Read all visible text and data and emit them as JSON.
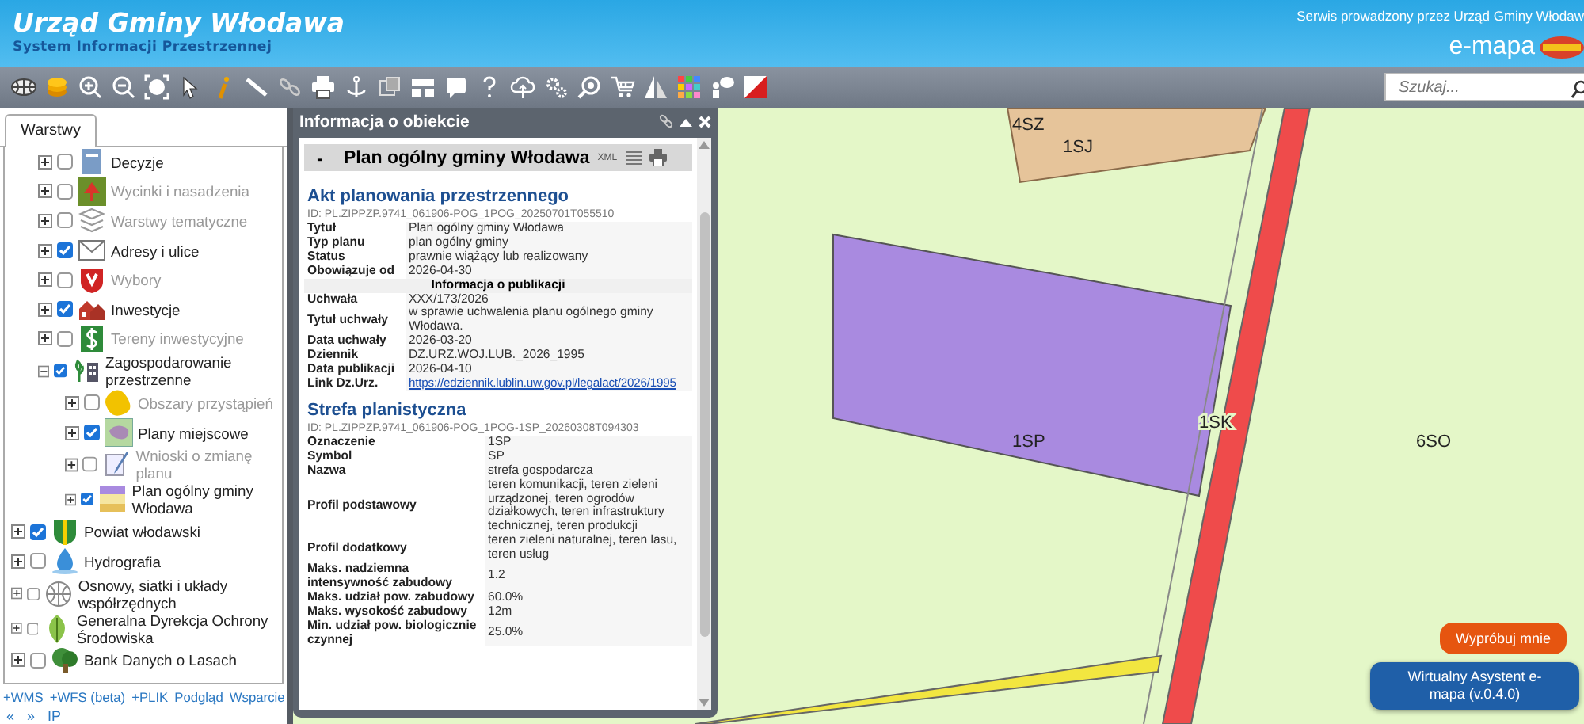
{
  "header": {
    "title": "Urząd Gminy Włodawa",
    "subtitle": "System Informacji Przestrzennej",
    "operator_note": "Serwis prowadzony przez Urząd Gminy Włodaw",
    "logo_text": "e-mapa"
  },
  "toolbar": {
    "search": {
      "placeholder": "Szukaj..."
    }
  },
  "layers_panel": {
    "tabs": [
      {
        "label": "Warstwy",
        "selected": true
      }
    ],
    "partial_group": [
      {
        "label": "Decyzje",
        "checked": false,
        "disabled": false,
        "expanded": false
      },
      {
        "label": "Wycinki i nasadzenia",
        "checked": false,
        "disabled": true,
        "expanded": false
      },
      {
        "label": "Warstwy tematyczne",
        "checked": false,
        "disabled": true,
        "expanded": false
      },
      {
        "label": "Adresy i ulice",
        "checked": true,
        "disabled": false,
        "expanded": false
      },
      {
        "label": "Wybory",
        "checked": false,
        "disabled": true,
        "expanded": false
      },
      {
        "label": "Inwestycje",
        "checked": true,
        "disabled": false,
        "expanded": false
      },
      {
        "label": "Tereny inwestycyjne",
        "checked": false,
        "disabled": true,
        "expanded": false
      },
      {
        "label": "Zagospodarowanie przestrzenne",
        "checked": true,
        "disabled": false,
        "expanded": true,
        "children": [
          {
            "label": "Obszary przystąpień",
            "checked": false,
            "disabled": true,
            "expanded": false
          },
          {
            "label": "Plany miejscowe",
            "checked": true,
            "disabled": false,
            "expanded": false
          },
          {
            "label": "Wnioski o zmianę planu",
            "checked": false,
            "disabled": true,
            "expanded": false
          },
          {
            "label": "Plan ogólny gminy Włodawa",
            "checked": true,
            "disabled": false,
            "expanded": false
          }
        ]
      }
    ],
    "items": [
      {
        "label": "Powiat włodawski",
        "checked": true,
        "disabled": false,
        "expanded": false
      },
      {
        "label": "Hydrografia",
        "checked": false,
        "disabled": false,
        "expanded": false
      },
      {
        "label": "Osnowy, siatki i układy współrzędnych",
        "checked": false,
        "disabled": false,
        "expanded": false
      },
      {
        "label": "Generalna Dyrekcja Ochrony Środowiska",
        "checked": false,
        "disabled": false,
        "expanded": false
      },
      {
        "label": "Bank Danych o Lasach",
        "checked": false,
        "disabled": false,
        "expanded": false
      }
    ],
    "links": [
      "+WMS",
      "+WFS (beta)",
      "+PLIK",
      "Podgląd",
      "Wsparcie"
    ],
    "footer_links": [
      "«",
      "»",
      "IP"
    ]
  },
  "info_popup": {
    "title": "Informacja o obiekcie",
    "object": {
      "collapse_symbol": "-",
      "title": "Plan ogólny gminy Włodawa",
      "xml_label": "XML"
    },
    "sections": [
      {
        "title": "Akt planowania przestrzennego",
        "id_line": "ID: PL.ZIPPZP.9741_061906-POG_1POG_20250701T055510",
        "rows": [
          {
            "kind": "field",
            "label": "Tytuł",
            "value": "Plan ogólny gminy Włodawa"
          },
          {
            "kind": "field",
            "label": "Typ planu",
            "value": "plan ogólny gminy"
          },
          {
            "kind": "field",
            "label": "Status",
            "value": "prawnie wiążący lub realizowany"
          },
          {
            "kind": "field",
            "label": "Obowiązuje od",
            "value": "2026-04-30"
          },
          {
            "kind": "subheader",
            "label": "Informacja o publikacji"
          },
          {
            "kind": "field",
            "label": "Uchwała",
            "value": "XXX/173/2026"
          },
          {
            "kind": "field",
            "label": "Tytuł uchwały",
            "value": "w sprawie uchwalenia planu ogólnego gminy Włodawa."
          },
          {
            "kind": "field",
            "label": "Data uchwały",
            "value": "2026-03-20"
          },
          {
            "kind": "field",
            "label": "Dziennik",
            "value": "DZ.URZ.WOJ.LUB._2026_1995"
          },
          {
            "kind": "field",
            "label": "Data publikacji",
            "value": "2026-04-10"
          },
          {
            "kind": "link",
            "label": "Link Dz.Urz.",
            "value": "https://edziennik.lublin.uw.gov.pl/legalact/2026/1995"
          }
        ]
      },
      {
        "title": "Strefa planistyczna",
        "id_line": "ID: PL.ZIPPZP.9741_061906-POG_1POG-1SP_20260308T094303",
        "rows": [
          {
            "kind": "field",
            "label": "Oznaczenie",
            "value": "1SP"
          },
          {
            "kind": "field",
            "label": "Symbol",
            "value": "SP"
          },
          {
            "kind": "field",
            "label": "Nazwa",
            "value": "strefa gospodarcza"
          },
          {
            "kind": "field",
            "label": "Profil podstawowy",
            "value": "teren komunikacji, teren zieleni urządzonej, teren ogrodów działkowych, teren infrastruktury technicznej, teren produkcji"
          },
          {
            "kind": "field",
            "label": "Profil dodatkowy",
            "value": "teren zieleni naturalnej, teren lasu, teren usług"
          },
          {
            "kind": "field",
            "label": "Maks. nadziemna intensywność zabudowy",
            "value": "1.2"
          },
          {
            "kind": "field",
            "label": "Maks. udział pow. zabudowy",
            "value": "60.0%"
          },
          {
            "kind": "field",
            "label": "Maks. wysokość zabudowy",
            "value": "12m"
          },
          {
            "kind": "field",
            "label": "Min. udział pow. biologicznie czynnej",
            "value": "25.0%"
          }
        ]
      }
    ]
  },
  "map": {
    "zone_labels": [
      "4SZ",
      "1SJ",
      "1SP",
      "1SK",
      "6SO"
    ]
  },
  "assistant": {
    "tooltip": "Wypróbuj mnie",
    "button": "Wirtualny Asystent e-mapa (v.0.4.0)"
  }
}
